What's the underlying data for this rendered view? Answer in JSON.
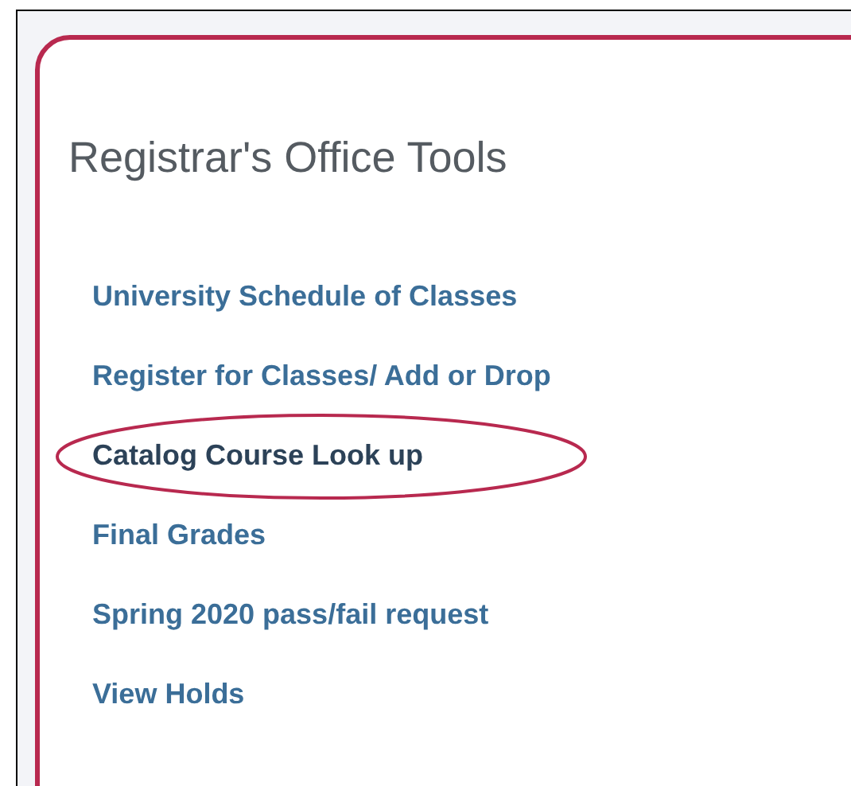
{
  "panel": {
    "title": "Registrar's Office Tools"
  },
  "links": [
    {
      "label": "University Schedule of Classes",
      "circled": false
    },
    {
      "label": "Register for Classes/ Add or Drop",
      "circled": false
    },
    {
      "label": "Catalog Course Look up",
      "circled": true
    },
    {
      "label": "Final Grades",
      "circled": false
    },
    {
      "label": "Spring 2020 pass/fail request",
      "circled": false
    },
    {
      "label": "View Holds",
      "circled": false
    }
  ]
}
